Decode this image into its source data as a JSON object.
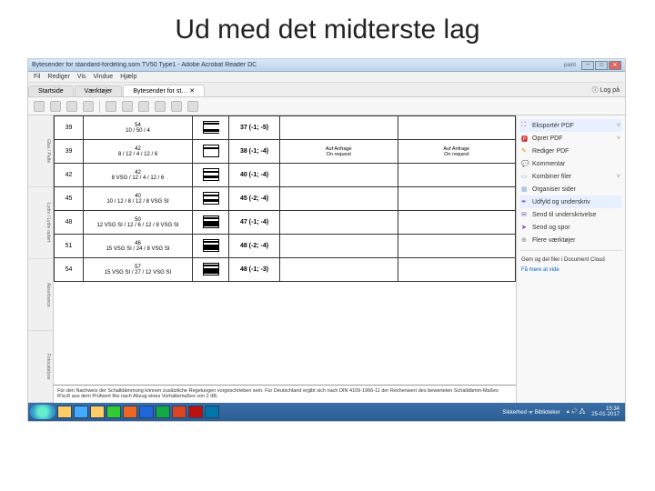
{
  "slide_title": "Ud med det midterste lag",
  "window": {
    "title": "Bytesender for standard-fordeling.som TV50 Type1 - Adobe Acrobat Reader DC",
    "paint_hint": "paint"
  },
  "menu": {
    "items": [
      "Fil",
      "Rediger",
      "Vis",
      "Vindue",
      "Hjælp"
    ]
  },
  "tabs": {
    "items": [
      "Startside",
      "Værktøjer",
      "Bytesender for st…  ✕"
    ],
    "login": "Log på",
    "login_icon": "ⓘ"
  },
  "toolbar_icons": [
    "save",
    "print",
    "mail",
    "search",
    "nav-left",
    "nav-right",
    "zoom-out",
    "zoom-in",
    "fit",
    "hand"
  ],
  "left_rail": [
    "Glas / Patte",
    "Lydnr / Lydnr opført",
    "Absorbance",
    "Fotocatalyse"
  ],
  "doc_rows": [
    {
      "l": "39",
      "mid_top": "54",
      "mid_bot": "10 / 50 / 4",
      "icon": "open",
      "val": "37 (-1; -5)",
      "note1": "",
      "note2": ""
    },
    {
      "l": "39",
      "mid_top": "42",
      "mid_bot": "8 / 12 / 4 / 12 / 6",
      "icon": "t1",
      "val": "38 (-1; -4)",
      "note1": "Auf Anfrage\nOn request",
      "note2": "Auf Anfrage\nOn request"
    },
    {
      "l": "42",
      "mid_top": "42",
      "mid_bot": "8 VSG / 12 / 4 / 12 / 6",
      "icon": "t2",
      "val": "40 (-1; -4)",
      "note1": "",
      "note2": ""
    },
    {
      "l": "45",
      "mid_top": "40",
      "mid_bot": "10 / 12 / 8 / 12 / 8 VSG SI",
      "icon": "t2",
      "val": "45 (-2; -4)",
      "note1": "",
      "note2": ""
    },
    {
      "l": "48",
      "mid_top": "50",
      "mid_bot": "12 VSG SI / 12 / 6 / 12 / 8 VSG SI",
      "icon": "t3",
      "val": "47 (-1; -4)",
      "note1": "",
      "note2": ""
    },
    {
      "l": "51",
      "mid_top": "46",
      "mid_bot": "15 VSG SI / 24 / 8 VSG SI",
      "icon": "t3",
      "val": "48 (-2; -4)",
      "note1": "",
      "note2": ""
    },
    {
      "l": "54",
      "mid_top": "57",
      "mid_bot": "15 VSG SI / 27 / 12 VSG SI",
      "icon": "t3",
      "val": "48 (-1; -3)",
      "note1": "",
      "note2": ""
    }
  ],
  "doc_footnote": "Für den Nachweis der Schalldämmung können zusätzliche Regelungen vorgeschrieben sein. Für Deutschland ergibt sich nach DIN 4109-1966-11 der Rechenwert des bewerteten Schalldämm-Maßes R'w,R aus dem Prüfwert Rw nach Abzug eines Vorhaltemaßes von 2 dB.",
  "right_panel": {
    "items": [
      {
        "label": "Eksportér PDF",
        "color": "#d33",
        "icon": "⛶",
        "expand": "˅",
        "hl": true
      },
      {
        "label": "Opret PDF",
        "color": "#c33",
        "icon": "🅿",
        "expand": "˅"
      },
      {
        "label": "Rediger PDF",
        "color": "#e80",
        "icon": "✎",
        "expand": ""
      },
      {
        "label": "Kommentar",
        "color": "#e80",
        "icon": "💬",
        "expand": ""
      },
      {
        "label": "Kombiner filer",
        "color": "#8ad",
        "icon": "▭",
        "expand": "˅"
      },
      {
        "label": "Organiser sider",
        "color": "#8ad",
        "icon": "▦",
        "expand": ""
      },
      {
        "label": "Udfyld og underskriv",
        "color": "#7a3fb5",
        "icon": "✒",
        "expand": "",
        "hl": true
      },
      {
        "label": "Send til underskrivelse",
        "color": "#7a3fb5",
        "icon": "✉",
        "expand": ""
      },
      {
        "label": "Send og spor",
        "color": "#7a3fb5",
        "icon": "➤",
        "expand": ""
      },
      {
        "label": "Flere værktøjer",
        "color": "#888",
        "icon": "⊕",
        "expand": ""
      }
    ],
    "cloud_text": "Gem og del filer i Document Cloud",
    "cloud_link": "Få mere at vide"
  },
  "taskbar": {
    "apps": [
      "explorer",
      "ie",
      "folder",
      "chrome",
      "firefox",
      "word",
      "excel",
      "ppt",
      "acrobat",
      "outlook"
    ],
    "tray_text": "Sikkerhed  ᯤ Biblioteker",
    "time": "15:34",
    "date": "25-01-2017"
  }
}
